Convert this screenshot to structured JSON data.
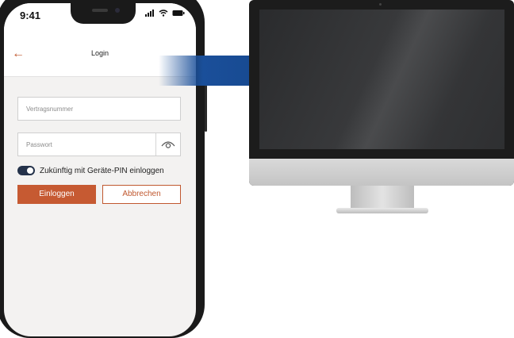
{
  "status_bar": {
    "time": "9:41",
    "icons": [
      "signal-icon",
      "wifi-icon",
      "battery-icon"
    ]
  },
  "nav": {
    "title": "Login",
    "back_icon": "arrow-left-icon"
  },
  "form": {
    "contract_placeholder": "Vertragsnummer",
    "password_placeholder": "Passwort",
    "toggle_label": "Zukünftig mit Geräte-PIN einloggen",
    "toggle_on": true,
    "submit_label": "Einloggen",
    "cancel_label": "Abbrechen"
  },
  "colors": {
    "accent": "#c65a32",
    "toggle": "#24324a",
    "arrow": "#1a4f9a",
    "screen_bg": "#f3f2f1"
  }
}
